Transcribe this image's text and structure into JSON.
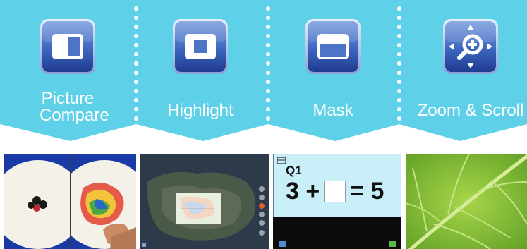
{
  "colors": {
    "banner": "#5ed0e8",
    "icon_blue_dark": "#1d3f95",
    "icon_blue_light": "#6f93d8",
    "text": "#ffffff"
  },
  "tools": [
    {
      "label_line1": "Picture",
      "label_line2": "Compare",
      "icon": "picture-compare-icon"
    },
    {
      "label": "Highlight",
      "icon": "highlight-icon"
    },
    {
      "label": "Mask",
      "icon": "mask-icon"
    },
    {
      "label": "Zoom & Scroll",
      "icon": "zoom-scroll-icon"
    }
  ],
  "previews": {
    "math": {
      "question": "Q1",
      "eq_left": "3 +",
      "eq_right": "= 5"
    }
  }
}
